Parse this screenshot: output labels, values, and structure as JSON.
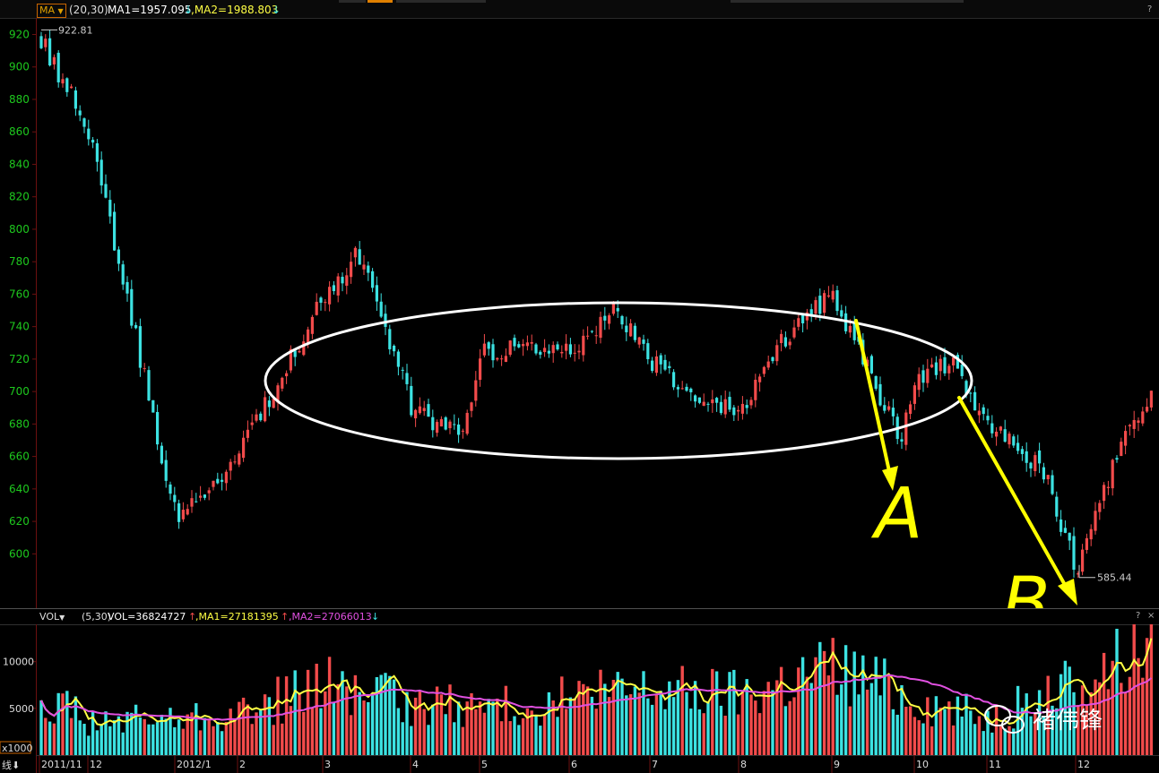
{
  "header": {
    "indicator": "MA",
    "params": "(20,30)",
    "ma1_label": "MA1=1957.095",
    "ma2_label": ",MA2=1988.803",
    "help": "?"
  },
  "volume_header": {
    "indicator": "VOL",
    "params": "(5,30)",
    "vol_label": "VOL=36824727",
    "ma1_label": ",MA1=27181395",
    "ma2_label": ",MA2=27066013",
    "help": "?",
    "close": "×"
  },
  "price_annotations": {
    "high": "922.81",
    "low": "585.44"
  },
  "handwriting": {
    "a": "A",
    "b": "B"
  },
  "watermark": "褚伟锋",
  "volume_axis": {
    "ticks": [
      "10000",
      "5000"
    ],
    "unit": "x1000"
  },
  "footer": {
    "switch": "线"
  },
  "colors": {
    "up": "#f24b4b",
    "down": "#3ce2e2",
    "ma1": "#ffff44",
    "ma2": "#e050e0",
    "axis_green": "#1ec81e",
    "annotation": "#ffff00"
  },
  "chart_data": [
    {
      "type": "candlestick",
      "title": "",
      "y_ticks": [
        600,
        620,
        640,
        660,
        680,
        700,
        720,
        740,
        760,
        780,
        800,
        820,
        840,
        860,
        880,
        900,
        920
      ],
      "ylim": [
        577,
        928
      ],
      "x_labels": [
        "2011/11",
        "12",
        "2012/1",
        "2",
        "3",
        "4",
        "5",
        "6",
        "7",
        "8",
        "9",
        "10",
        "11",
        "12"
      ],
      "period": [
        "2011/11",
        "2012/12"
      ],
      "high": 922.81,
      "low": 585.44,
      "legend": [
        "MA1=1957.095",
        "MA2=1988.803"
      ],
      "legend_position": "top-left",
      "grid": false,
      "key_points": [
        {
          "month": "2011/11",
          "close": 920
        },
        {
          "month": "12",
          "close": 860
        },
        {
          "month": "2012/1",
          "close": 620
        },
        {
          "month": "2",
          "close": 660
        },
        {
          "month": "3",
          "close": 760
        },
        {
          "month": "3.5",
          "close": 785
        },
        {
          "month": "4",
          "close": 690
        },
        {
          "month": "4.5",
          "close": 670
        },
        {
          "month": "5",
          "close": 725
        },
        {
          "month": "6",
          "close": 725
        },
        {
          "month": "6.5",
          "close": 750
        },
        {
          "month": "7",
          "close": 720
        },
        {
          "month": "7.5",
          "close": 690
        },
        {
          "month": "8",
          "close": 690
        },
        {
          "month": "8.5",
          "close": 745
        },
        {
          "month": "9",
          "close": 760
        },
        {
          "month": "9.5",
          "close": 670
        },
        {
          "month": "10",
          "close": 710
        },
        {
          "month": "10.5",
          "close": 715
        },
        {
          "month": "11",
          "close": 680
        },
        {
          "month": "11.5",
          "close": 650
        },
        {
          "month": "12",
          "close": 590
        },
        {
          "month": "12.5",
          "close": 640
        },
        {
          "month": "end",
          "close": 705
        }
      ]
    },
    {
      "type": "bar",
      "title": "",
      "y_ticks": [
        5000,
        10000
      ],
      "ylim": [
        0,
        14000
      ],
      "unit": "x1000",
      "legend": [
        "VOL=36824727",
        "MA1=27181395",
        "MA2=27066013"
      ],
      "legend_position": "top-left",
      "grid": false,
      "level_points": [
        {
          "month": "2011/11",
          "volume": 7000
        },
        {
          "month": "12",
          "volume": 3500
        },
        {
          "month": "2012/1",
          "volume": 4000
        },
        {
          "month": "2",
          "volume": 4500
        },
        {
          "month": "3",
          "volume": 7500
        },
        {
          "month": "4",
          "volume": 5500
        },
        {
          "month": "5",
          "volume": 5000
        },
        {
          "month": "6",
          "volume": 6000
        },
        {
          "month": "7",
          "volume": 7000
        },
        {
          "month": "8",
          "volume": 6500
        },
        {
          "month": "9",
          "volume": 9500
        },
        {
          "month": "10",
          "volume": 6000
        },
        {
          "month": "11",
          "volume": 4000
        },
        {
          "month": "12",
          "volume": 7500
        },
        {
          "month": "end",
          "volume": 12000
        }
      ]
    }
  ]
}
